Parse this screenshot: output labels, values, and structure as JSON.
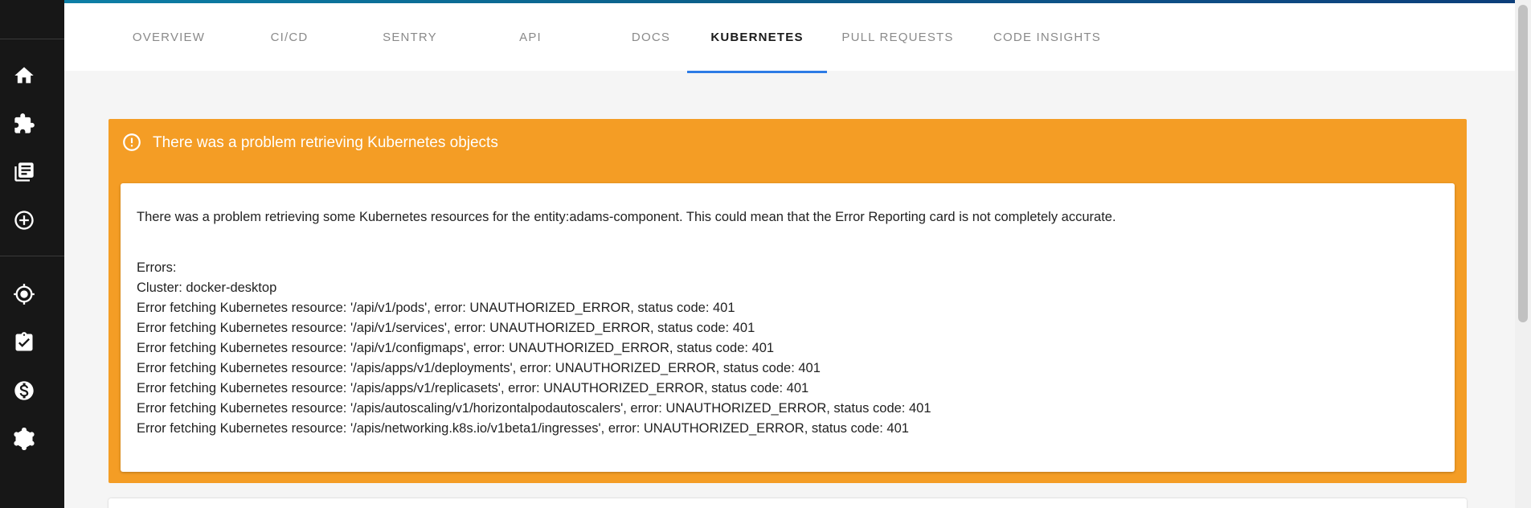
{
  "sidebar": {
    "icons": [
      {
        "name": "home-icon"
      },
      {
        "name": "extension-icon"
      },
      {
        "name": "library-books-icon"
      },
      {
        "name": "add-circle-icon"
      },
      {
        "name": "gps-fixed-icon"
      },
      {
        "name": "assignment-turned-in-icon"
      },
      {
        "name": "monetization-icon"
      },
      {
        "name": "graphql-icon"
      }
    ]
  },
  "tabs": [
    {
      "label": "OVERVIEW"
    },
    {
      "label": "CI/CD"
    },
    {
      "label": "SENTRY"
    },
    {
      "label": "API"
    },
    {
      "label": "DOCS"
    },
    {
      "label": "KUBERNETES",
      "active": true
    },
    {
      "label": "PULL REQUESTS"
    },
    {
      "label": "CODE INSIGHTS"
    }
  ],
  "alert": {
    "icon": "error-outline-icon",
    "title": "There was a problem retrieving Kubernetes objects",
    "summary": "There was a problem retrieving some Kubernetes resources for the entity:adams-component. This could mean that the Error Reporting card is not completely accurate.",
    "errors_label": "Errors:",
    "cluster": "Cluster: docker-desktop",
    "error_lines": [
      "Error fetching Kubernetes resource: '/api/v1/pods', error: UNAUTHORIZED_ERROR, status code: 401",
      "Error fetching Kubernetes resource: '/api/v1/services', error: UNAUTHORIZED_ERROR, status code: 401",
      "Error fetching Kubernetes resource: '/api/v1/configmaps', error: UNAUTHORIZED_ERROR, status code: 401",
      "Error fetching Kubernetes resource: '/apis/apps/v1/deployments', error: UNAUTHORIZED_ERROR, status code: 401",
      "Error fetching Kubernetes resource: '/apis/apps/v1/replicasets', error: UNAUTHORIZED_ERROR, status code: 401",
      "Error fetching Kubernetes resource: '/apis/autoscaling/v1/horizontalpodautoscalers', error: UNAUTHORIZED_ERROR, status code: 401",
      "Error fetching Kubernetes resource: '/apis/networking.k8s.io/v1beta1/ingresses', error: UNAUTHORIZED_ERROR, status code: 401"
    ]
  },
  "colors": {
    "sidebar_bg": "#171717",
    "warning": "#f49d25",
    "tab_indicator": "#2c7be5"
  }
}
